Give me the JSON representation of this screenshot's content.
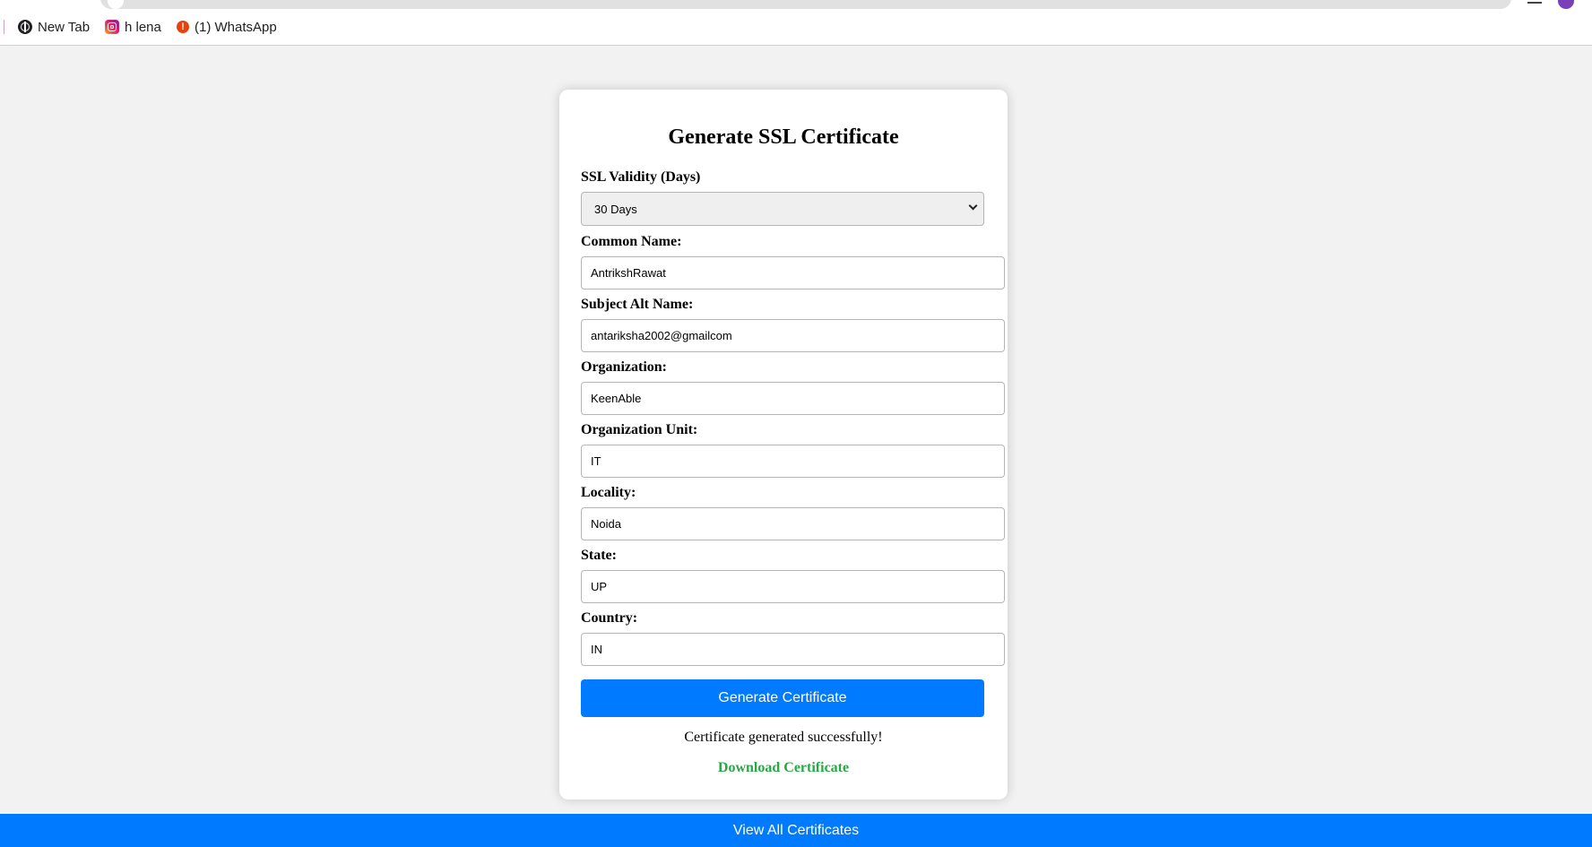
{
  "bookmarks": [
    {
      "label": "New Tab",
      "icon": "globe-icon"
    },
    {
      "label": "h lena",
      "icon": "instagram-icon"
    },
    {
      "label": "(1) WhatsApp",
      "icon": "alert-icon"
    }
  ],
  "form": {
    "title": "Generate SSL Certificate",
    "validity": {
      "label": "SSL Validity (Days)",
      "selected": "30 Days"
    },
    "common_name": {
      "label": "Common Name:",
      "value": "AntrikshRawat"
    },
    "subject_alt_name": {
      "label": "Subject Alt Name:",
      "value": "antariksha2002@gmailcom"
    },
    "organization": {
      "label": "Organization:",
      "value": "KeenAble"
    },
    "organization_unit": {
      "label": "Organization Unit:",
      "value": "IT"
    },
    "locality": {
      "label": "Locality:",
      "value": "Noida"
    },
    "state": {
      "label": "State:",
      "value": "UP"
    },
    "country": {
      "label": "Country:",
      "value": "IN"
    },
    "submit_label": "Generate Certificate",
    "success_message": "Certificate generated successfully!",
    "download_label": "Download Certificate"
  },
  "footer": {
    "view_all_label": "View All Certificates"
  },
  "colors": {
    "primary": "#007bff",
    "success": "#28a745",
    "page_background": "#f2f2f2"
  }
}
